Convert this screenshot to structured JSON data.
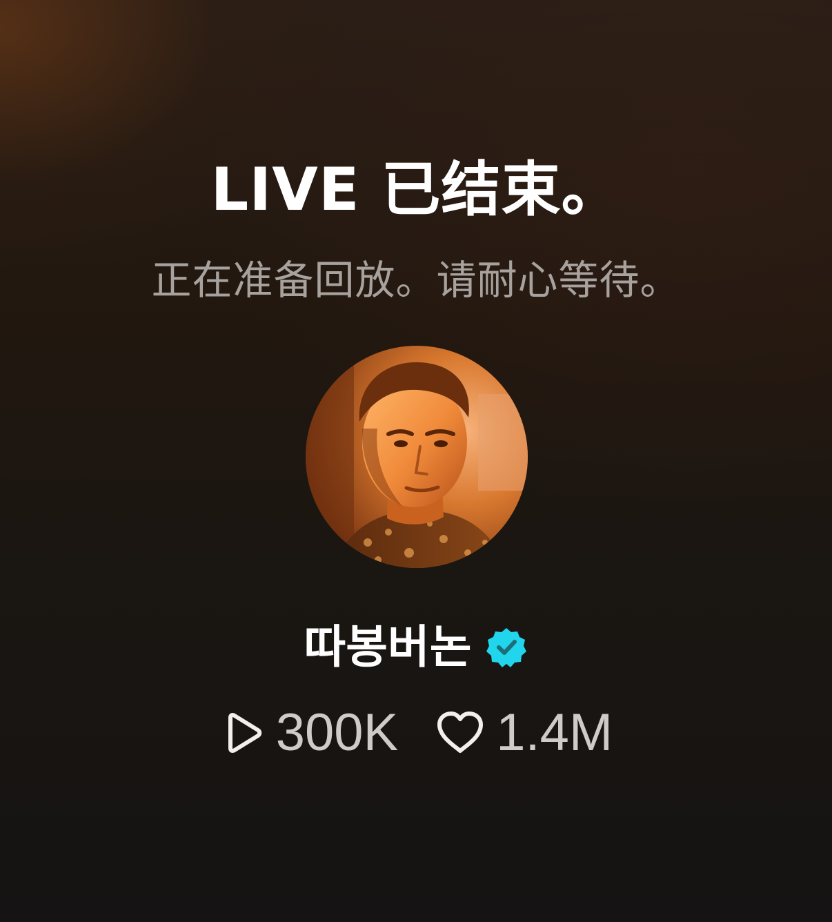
{
  "live_ended": {
    "title": "LIVE 已结束。",
    "subtitle": "正在准备回放。请耐心等待。"
  },
  "profile": {
    "avatar_icon": "profile-photo",
    "username": "따봉버논",
    "verified_icon": "verified-badge-icon",
    "verified_color": "#20D5EC"
  },
  "stats": {
    "views_icon": "play-icon",
    "views": "300K",
    "likes_icon": "heart-icon",
    "likes": "1.4M"
  }
}
